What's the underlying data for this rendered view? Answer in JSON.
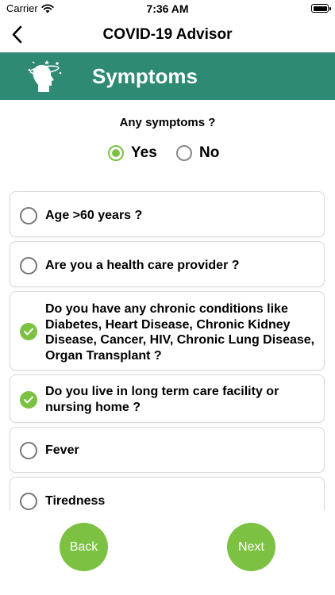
{
  "status_bar": {
    "carrier": "Carrier",
    "time": "7:36 AM"
  },
  "nav": {
    "title": "COVID-19 Advisor"
  },
  "banner": {
    "title": "Symptoms",
    "color": "#2f8a74"
  },
  "question": {
    "text": "Any symptoms ?",
    "options": [
      {
        "label": "Yes",
        "selected": true
      },
      {
        "label": "No",
        "selected": false
      }
    ]
  },
  "items": [
    {
      "label": "Age >60 years ?",
      "checked": false
    },
    {
      "label": "Are you a health care provider ?",
      "checked": false
    },
    {
      "label": "Do you have any chronic conditions like Diabetes, Heart Disease, Chronic Kidney Disease, Cancer, HIV, Chronic Lung Disease, Organ Transplant ?",
      "checked": true
    },
    {
      "label": "Do you live in long term care facility or nursing home ?",
      "checked": true
    },
    {
      "label": "Fever",
      "checked": false
    },
    {
      "label": "Tiredness",
      "checked": false
    }
  ],
  "buttons": {
    "back": "Back",
    "next": "Next"
  },
  "colors": {
    "accent": "#7cc142"
  }
}
